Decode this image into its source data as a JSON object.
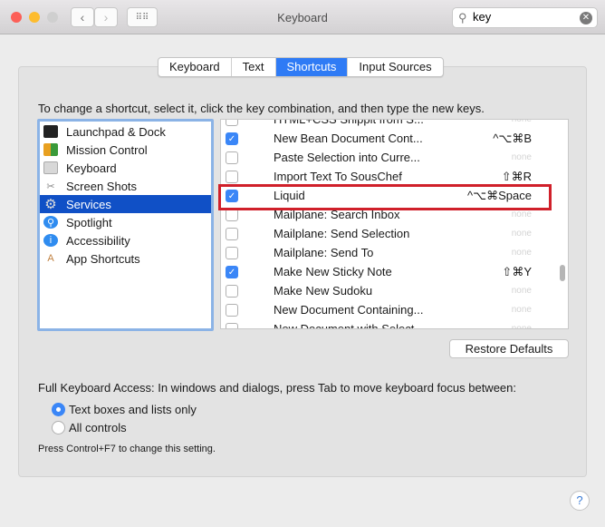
{
  "window": {
    "title": "Keyboard"
  },
  "search": {
    "value": "key"
  },
  "tabs": [
    {
      "label": "Keyboard"
    },
    {
      "label": "Text"
    },
    {
      "label": "Shortcuts",
      "selected": true
    },
    {
      "label": "Input Sources"
    }
  ],
  "instructions": "To change a shortcut, select it, click the key combination, and then type the new keys.",
  "categories": [
    {
      "label": "Launchpad & Dock",
      "icon": "launchpad-icon"
    },
    {
      "label": "Mission Control",
      "icon": "mission-control-icon"
    },
    {
      "label": "Keyboard",
      "icon": "keyboard-icon"
    },
    {
      "label": "Screen Shots",
      "icon": "screenshot-icon"
    },
    {
      "label": "Services",
      "icon": "gear-icon",
      "selected": true
    },
    {
      "label": "Spotlight",
      "icon": "spotlight-icon"
    },
    {
      "label": "Accessibility",
      "icon": "accessibility-icon"
    },
    {
      "label": "App Shortcuts",
      "icon": "app-shortcuts-icon"
    }
  ],
  "shortcuts": [
    {
      "checked": false,
      "name": "HTML+CSS Snippit from S...",
      "key": "none"
    },
    {
      "checked": true,
      "name": "New Bean Document Cont...",
      "key": "^⌥⌘B"
    },
    {
      "checked": false,
      "name": "Paste Selection into Curre...",
      "key": "none"
    },
    {
      "checked": false,
      "name": "Import Text To SousChef",
      "key": "⇧⌘R"
    },
    {
      "checked": true,
      "name": "Liquid",
      "key": "^⌥⌘Space"
    },
    {
      "checked": false,
      "name": "Mailplane: Search Inbox",
      "key": "none"
    },
    {
      "checked": false,
      "name": "Mailplane: Send Selection",
      "key": "none"
    },
    {
      "checked": false,
      "name": "Mailplane: Send To",
      "key": "none"
    },
    {
      "checked": true,
      "name": "Make New Sticky Note",
      "key": "⇧⌘Y"
    },
    {
      "checked": false,
      "name": "Make New Sudoku",
      "key": "none"
    },
    {
      "checked": false,
      "name": "New Document Containing...",
      "key": "none"
    },
    {
      "checked": false,
      "name": "New Document with Select...",
      "key": "none"
    }
  ],
  "restore_label": "Restore Defaults",
  "fka_label": "Full Keyboard Access: In windows and dialogs, press Tab to move keyboard focus between:",
  "radios": [
    {
      "label": "Text boxes and lists only",
      "selected": true
    },
    {
      "label": "All controls",
      "selected": false
    }
  ],
  "note": "Press Control+F7 to change this setting.",
  "help_label": "?",
  "colors": {
    "accent": "#2f7bf5",
    "highlight": "#d0202a",
    "selection": "#1050c6"
  }
}
